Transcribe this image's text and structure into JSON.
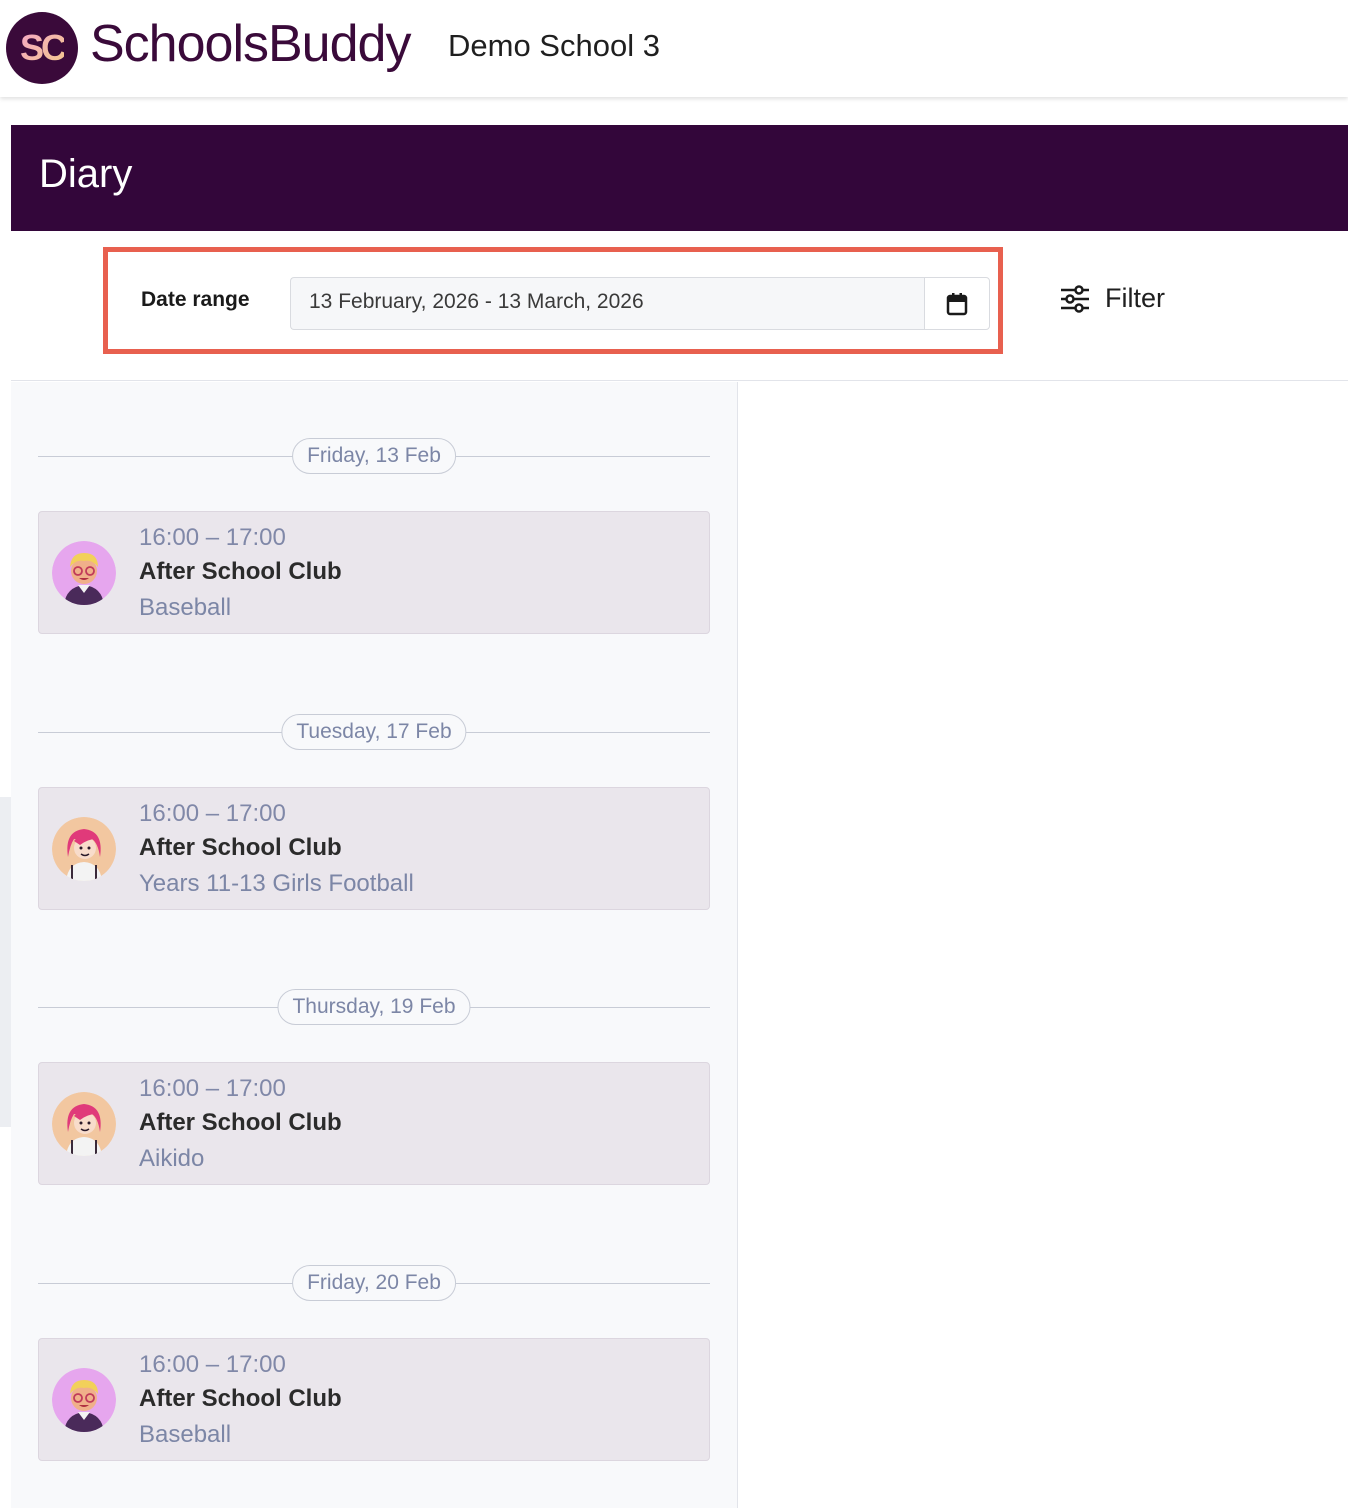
{
  "header": {
    "logo_text": "SC",
    "brand": "SchoolsBuddy",
    "school_name": "Demo School 3"
  },
  "page": {
    "title": "Diary"
  },
  "filters": {
    "date_range_label": "Date range",
    "date_range_value": "13 February, 2026 - 13 March, 2026",
    "calendar_icon": "calendar-icon",
    "filter_label": "Filter",
    "filter_icon": "sliders-icon"
  },
  "days": [
    {
      "date": "Friday, 13 Feb",
      "event": {
        "time": "16:00 – 17:00",
        "title": "After School Club",
        "subtitle": "Baseball",
        "avatar": "boy-avatar"
      }
    },
    {
      "date": "Tuesday, 17 Feb",
      "event": {
        "time": "16:00 – 17:00",
        "title": "After School Club",
        "subtitle": "Years 11-13 Girls Football",
        "avatar": "girl-avatar"
      }
    },
    {
      "date": "Thursday, 19 Feb",
      "event": {
        "time": "16:00 – 17:00",
        "title": "After School Club",
        "subtitle": "Aikido",
        "avatar": "girl-avatar"
      }
    },
    {
      "date": "Friday, 20 Feb",
      "event": {
        "time": "16:00 – 17:00",
        "title": "After School Club",
        "subtitle": "Baseball",
        "avatar": "boy-avatar"
      }
    }
  ],
  "colors": {
    "brand_purple": "#33063a",
    "highlight": "#e8604f",
    "card_bg": "#eae6ec",
    "muted_text": "#7c86a6"
  }
}
